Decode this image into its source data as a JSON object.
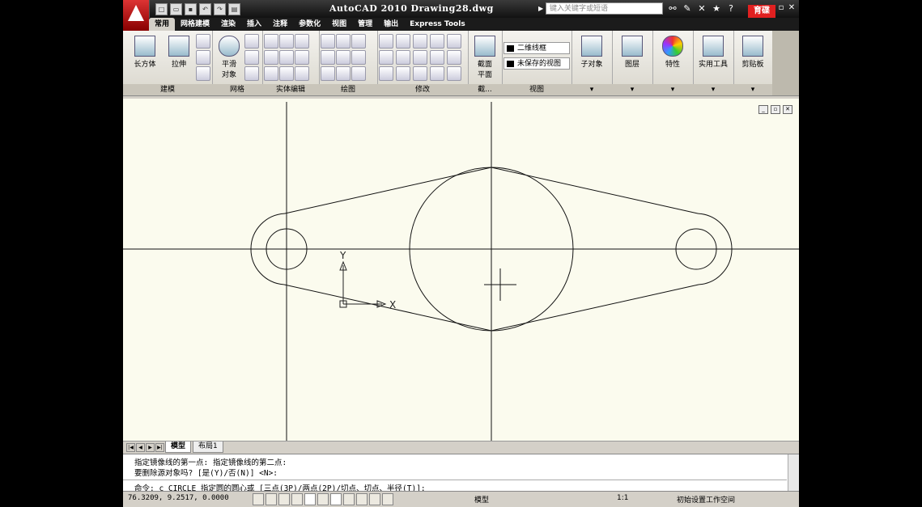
{
  "window": {
    "title": "AutoCAD 2010  Drawing28.dwg",
    "search_placeholder": "键入关键字或短语",
    "logo_text": "育碟教育"
  },
  "tabs": [
    "常用",
    "网格建模",
    "渲染",
    "插入",
    "注释",
    "参数化",
    "视图",
    "管理",
    "输出",
    "Express Tools"
  ],
  "active_tab": "常用",
  "ribbon": {
    "modeling": {
      "box_label": "长方体",
      "extrude_label": "拉伸",
      "title": "建模"
    },
    "mesh": {
      "smooth_label_1": "平滑",
      "smooth_label_2": "对象",
      "title": "网格"
    },
    "solid_edit": {
      "title": "实体编辑"
    },
    "draw": {
      "title": "绘图"
    },
    "modify": {
      "title": "修改"
    },
    "section": {
      "label_1": "截面",
      "label_2": "平面",
      "title": "截..."
    },
    "view": {
      "visual_style": "二维线框",
      "saved_view": "未保存的视图",
      "title": "视图"
    },
    "subobject": {
      "label": "子对象"
    },
    "layers": {
      "label": "图层"
    },
    "properties": {
      "label": "特性"
    },
    "utilities": {
      "label": "实用工具"
    },
    "clipboard": {
      "label": "剪贴板"
    }
  },
  "drawing": {
    "ucs_x_label": "X",
    "ucs_y_label": "Y"
  },
  "layout_tabs": [
    "模型",
    "布局1"
  ],
  "command": {
    "line1": "指定镜像线的第一点: 指定镜像线的第二点:",
    "line2": "要删除源对象吗? [是(Y)/否(N)] <N>:",
    "prompt": "命令: c CIRCLE 指定圆的圆心或 [三点(3P)/两点(2P)/切点、切点、半径(T)]:"
  },
  "status": {
    "coordinates": "76.3209, 9.2517, 0.0000",
    "model_label": "模型",
    "scale": "1:1",
    "workspace": "初始设置工作空间"
  }
}
